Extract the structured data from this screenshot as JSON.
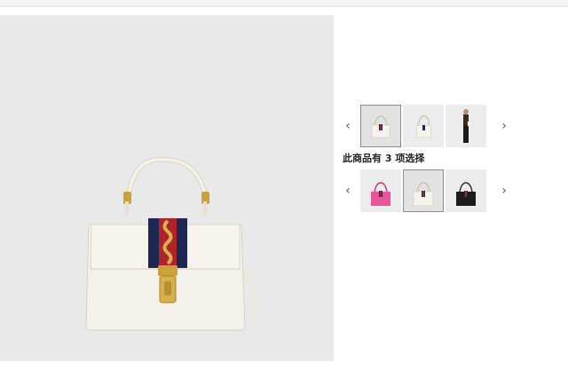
{
  "gallery": {
    "prev_icon": "chevron-left",
    "next_icon": "chevron-right",
    "thumbnails": [
      {
        "name": "front view"
      },
      {
        "name": "side view"
      },
      {
        "name": "model view"
      }
    ],
    "selected_index": 0
  },
  "variants": {
    "label": "此商品有 3 项选择",
    "prev_icon": "chevron-left",
    "next_icon": "chevron-right",
    "options": [
      {
        "color": "#e8559a"
      },
      {
        "color": "#f4f1ea"
      },
      {
        "color": "#1d1d1d"
      }
    ],
    "selected_index": 1
  },
  "colors": {
    "bag_body": "#f4f1ea",
    "stripe_navy": "#1e2752",
    "stripe_red": "#b0232a",
    "hardware_gold": "#c9a23a",
    "background": "#e9e9e9"
  }
}
